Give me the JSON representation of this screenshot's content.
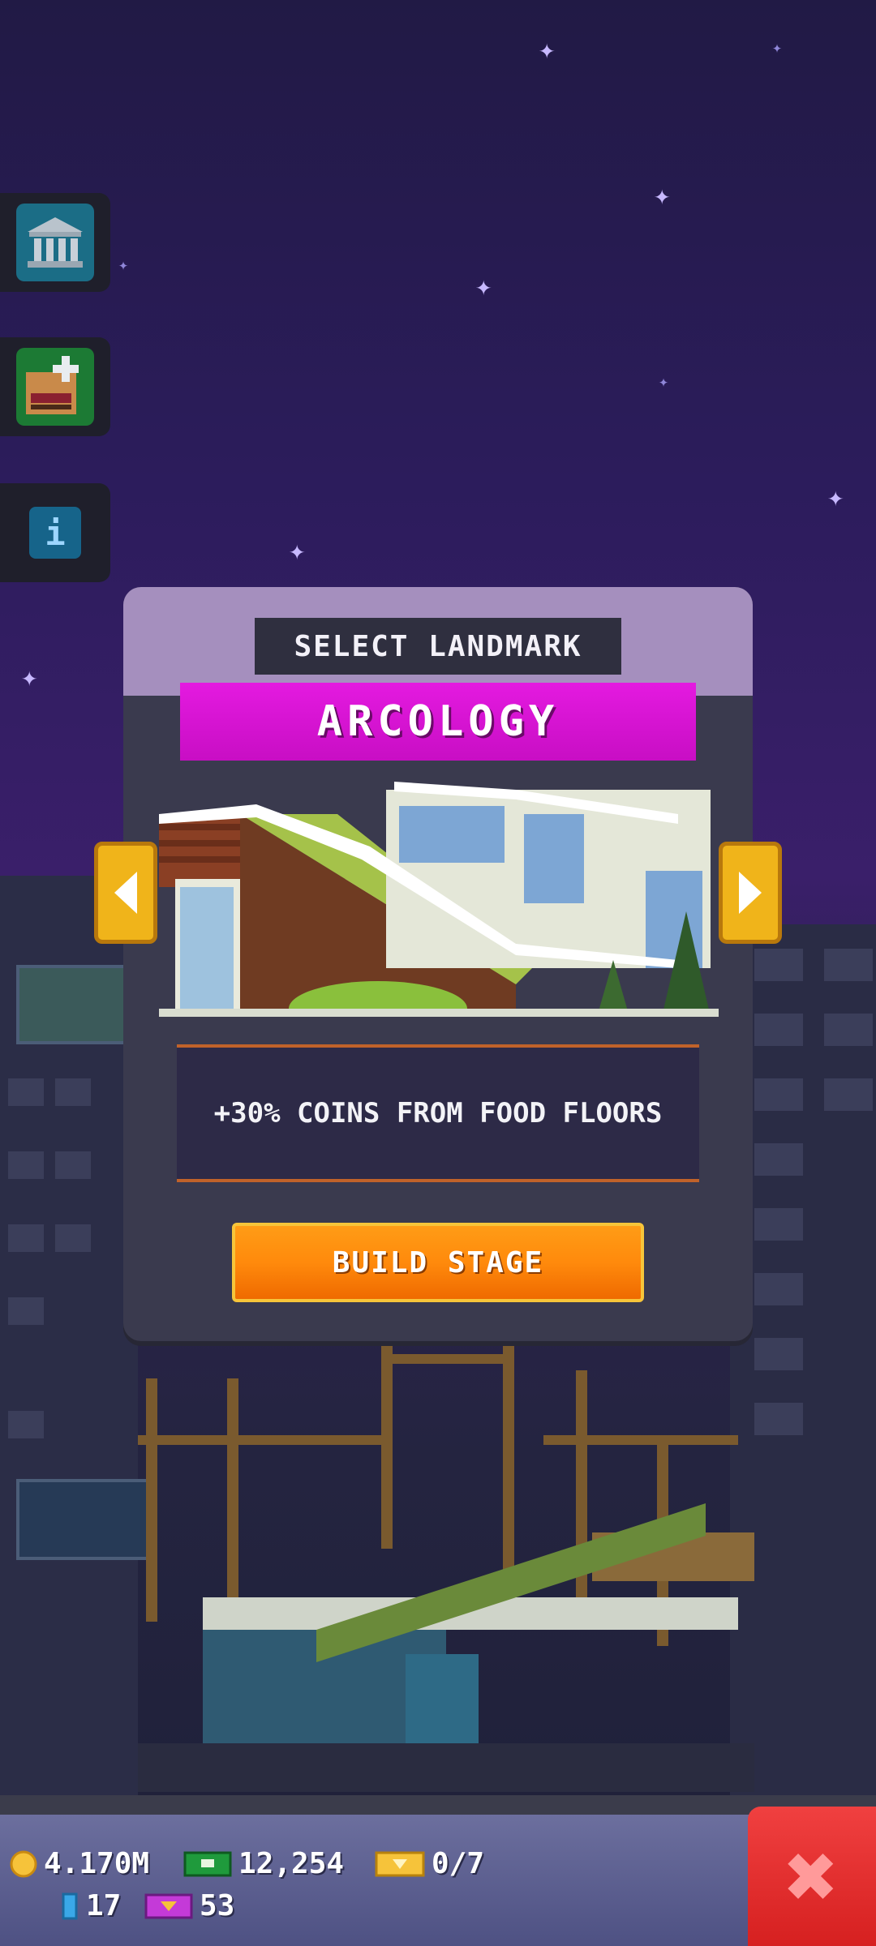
{
  "modal": {
    "title": "SELECT LANDMARK",
    "landmark_name": "ARCOLOGY",
    "description": "+30% COINS FROM FOOD FLOORS",
    "build_button": "BUILD STAGE"
  },
  "side_buttons": [
    {
      "name": "bank",
      "icon": "bank-icon"
    },
    {
      "name": "build",
      "icon": "blueprint-plus-icon"
    },
    {
      "name": "info",
      "icon": "info-icon",
      "label": "i"
    }
  ],
  "resources": {
    "coins": "4.170M",
    "bux": "12,254",
    "tickets": "0/7",
    "gems": "17",
    "vip": "53"
  },
  "close_label": "✖",
  "colors": {
    "banner": "#d312d0",
    "build_button": "#ff8a0c",
    "close_button": "#e33030"
  }
}
